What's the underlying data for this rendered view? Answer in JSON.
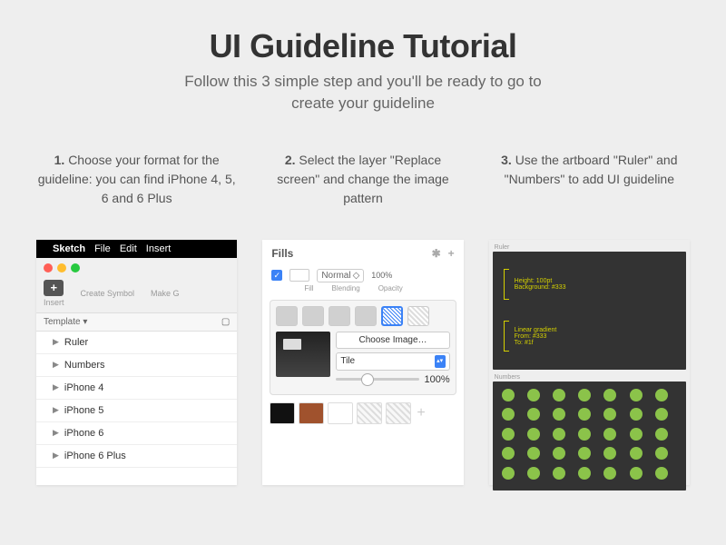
{
  "title": "UI Guideline Tutorial",
  "subtitle_l1": "Follow this 3 simple step and you'll be ready to go to",
  "subtitle_l2": "create your guideline",
  "steps": [
    {
      "num": "1.",
      "text": "Choose your format for the guideline: you can find iPhone 4, 5, 6 and 6 Plus"
    },
    {
      "num": "2.",
      "text": "Select the layer \"Replace screen\" and change the image pattern"
    },
    {
      "num": "3.",
      "text": "Use the artboard \"Ruler\" and \"Numbers\" to add UI guideline"
    }
  ],
  "menubar": {
    "app": "Sketch",
    "items": [
      "File",
      "Edit",
      "Insert"
    ]
  },
  "toolbar": {
    "insert": "Insert",
    "create_symbol": "Create Symbol",
    "make_g": "Make G"
  },
  "template_label": "Template",
  "layers": [
    "Ruler",
    "Numbers",
    "iPhone 4",
    "iPhone 5",
    "iPhone 6",
    "iPhone 6 Plus"
  ],
  "fills": {
    "header": "Fills",
    "blend": "Normal",
    "opacity": "100%",
    "label_fill": "Fill",
    "label_blending": "Blending",
    "label_opacity": "Opacity",
    "choose_image": "Choose Image…",
    "tile": "Tile",
    "slider_val": "100%"
  },
  "ruler_art": {
    "label": "Ruler",
    "item1_l1": "Height: 100pt",
    "item1_l2": "Background: #333",
    "item2_l1": "Linear gradient",
    "item2_l2": "From: #333",
    "item2_l3": "To: #1f"
  },
  "numbers_art": {
    "label": "Numbers"
  }
}
